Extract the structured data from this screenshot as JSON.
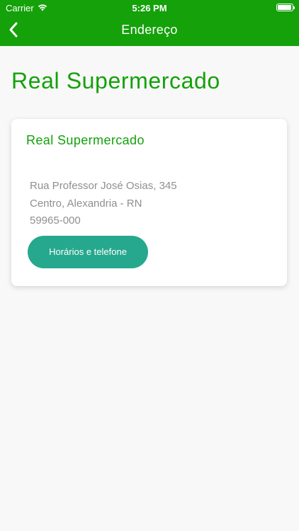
{
  "status_bar": {
    "carrier": "Carrier",
    "time": "5:26 PM"
  },
  "nav": {
    "title": "Endereço",
    "back_icon": "chevron-left-icon"
  },
  "page": {
    "title": "Real Supermercado"
  },
  "store_card": {
    "name": "Real Supermercado",
    "address_line1": "Rua Professor José Osias, 345",
    "address_line2": "Centro, Alexandria - RN",
    "postal_code": "59965-000",
    "hours_button_label": "Horários e telefone"
  },
  "colors": {
    "brand_green": "#14a10a",
    "button_teal": "#26a88e",
    "background": "#f8f8f8",
    "muted_text": "#8f8f8f"
  }
}
